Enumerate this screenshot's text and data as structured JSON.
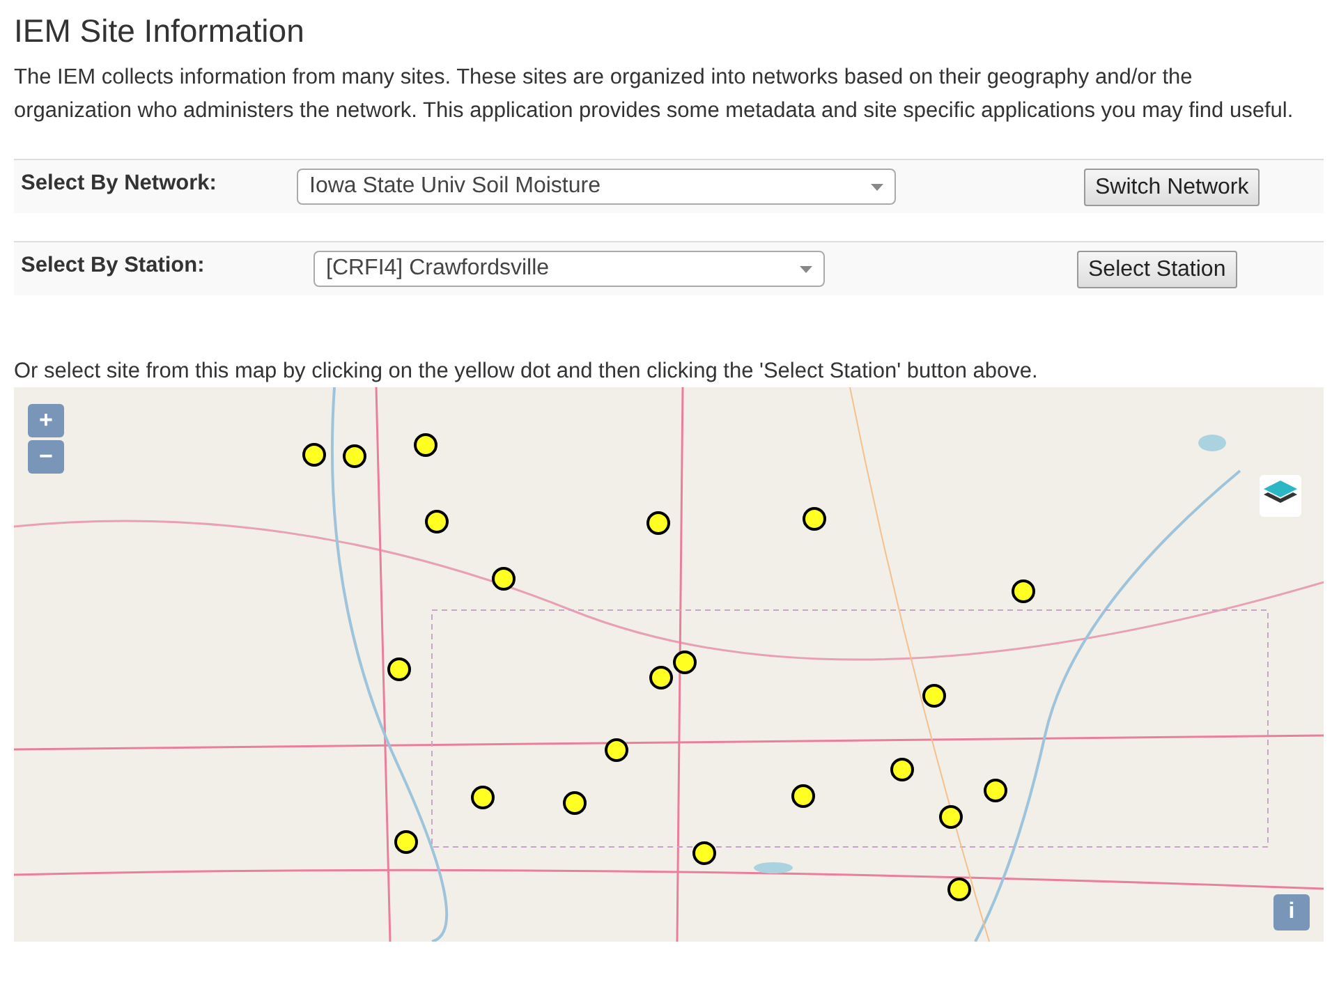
{
  "title": "IEM Site Information",
  "intro": "The IEM collects information from many sites. These sites are organized into networks based on their geography and/or the organization who administers the network. This application provides some metadata and site specific applications you may find useful.",
  "selectors": [
    {
      "label": "Select By Network:",
      "value": "Iowa State Univ Soil Moisture",
      "button": "Switch Network"
    },
    {
      "label": "Select By Station:",
      "value": "[CRFI4] Crawfordsville",
      "button": "Select Station"
    }
  ],
  "map_hint": "Or select site from this map by clicking on the yellow dot and then clicking the 'Select Station' button above.",
  "map": {
    "kind": "picture",
    "zoom_in": "+",
    "zoom_out": "−",
    "info": "i"
  }
}
